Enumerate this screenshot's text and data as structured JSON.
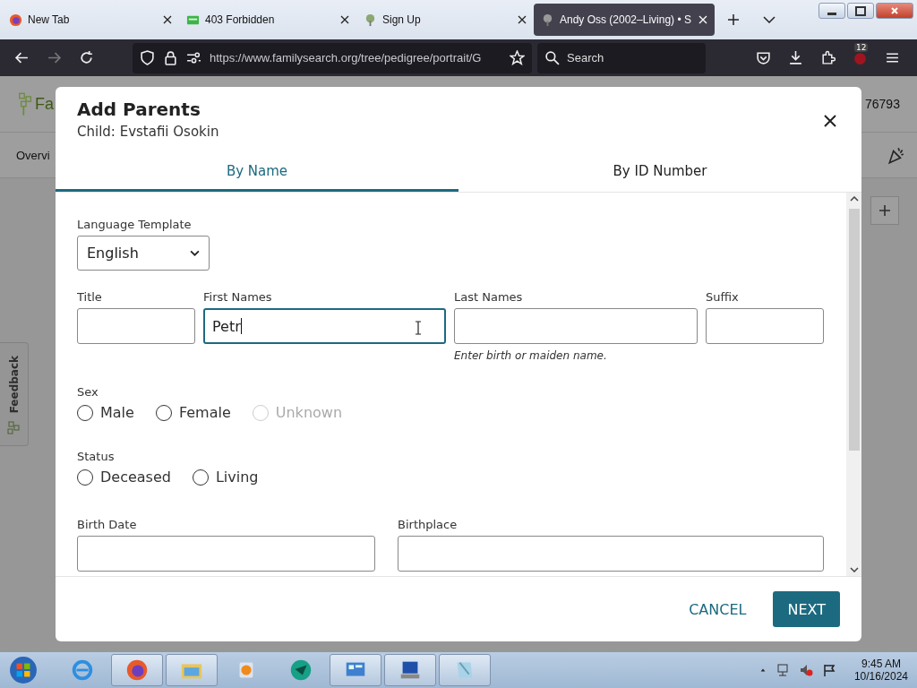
{
  "browser": {
    "tabs": [
      {
        "title": "New Tab",
        "selected": false
      },
      {
        "title": "403 Forbidden",
        "selected": false
      },
      {
        "title": "Sign Up",
        "selected": false
      },
      {
        "title": "Andy Oss (2002–Living) • S",
        "selected": true
      }
    ],
    "url": "https://www.familysearch.org/tree/pedigree/portrait/G",
    "search": {
      "placeholder": "Search"
    },
    "extension_badge": "12"
  },
  "background": {
    "logo_text": "Fa",
    "person_id": "76793",
    "nav_item": "Overvi",
    "feedback": "Feedback"
  },
  "dialog": {
    "title": "Add Parents",
    "subtitle": "Child: Evstafii Osokin",
    "tabs": [
      {
        "label": "By Name",
        "selected": true
      },
      {
        "label": "By ID Number",
        "selected": false
      }
    ],
    "language": {
      "label": "Language Template",
      "value": "English"
    },
    "name_fields": [
      {
        "label": "Title",
        "focused": false
      },
      {
        "label": "First Names",
        "value": "Petr",
        "focused": true
      },
      {
        "label": "Last Names",
        "focused": false,
        "hint": "Enter birth or maiden name."
      },
      {
        "label": "Suffix",
        "focused": false
      }
    ],
    "sex": {
      "label": "Sex",
      "options": [
        {
          "label": "Male",
          "selected": false,
          "disabled": false
        },
        {
          "label": "Female",
          "selected": false,
          "disabled": false
        },
        {
          "label": "Unknown",
          "selected": false,
          "disabled": true
        }
      ]
    },
    "status": {
      "label": "Status",
      "options": [
        {
          "label": "Deceased",
          "selected": false,
          "disabled": false
        },
        {
          "label": "Living",
          "selected": false,
          "disabled": false
        }
      ]
    },
    "date_fields": [
      {
        "label": "Birth Date"
      },
      {
        "label": "Birthplace"
      }
    ],
    "buttons": [
      {
        "label": "CANCEL",
        "kind": "text"
      },
      {
        "label": "NEXT",
        "kind": "primary"
      }
    ]
  },
  "taskbar": {
    "apps": [
      {
        "running": false
      },
      {
        "running": true
      },
      {
        "running": true
      },
      {
        "running": false
      },
      {
        "running": false
      },
      {
        "running": true
      },
      {
        "running": true
      },
      {
        "running": true
      }
    ],
    "time": "9:45 AM",
    "date": "10/16/2024"
  }
}
